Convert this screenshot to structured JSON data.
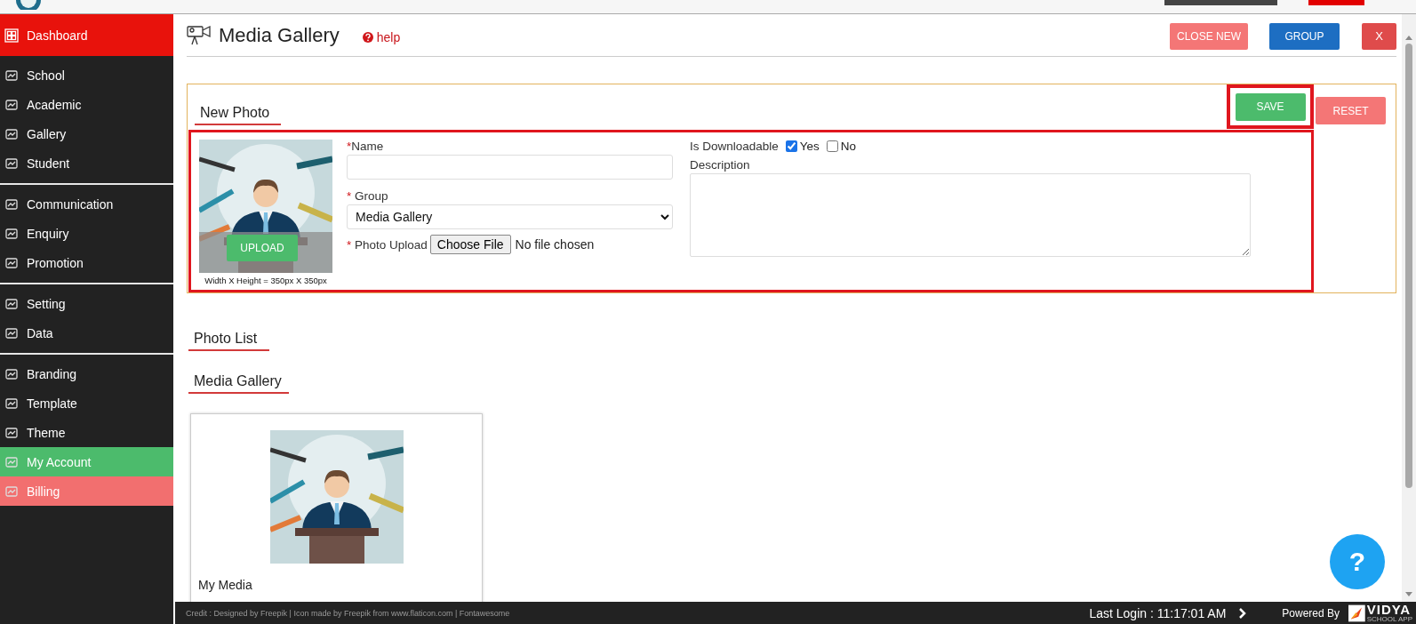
{
  "sidebar": {
    "groups": [
      {
        "items": [
          {
            "label": "Dashboard",
            "color": "#e8120c"
          }
        ]
      },
      {
        "items": [
          {
            "label": "School"
          },
          {
            "label": "Academic"
          },
          {
            "label": "Gallery"
          },
          {
            "label": "Student"
          }
        ]
      },
      {
        "items": [
          {
            "label": "Communication"
          },
          {
            "label": "Enquiry"
          },
          {
            "label": "Promotion"
          }
        ]
      },
      {
        "items": [
          {
            "label": "Setting"
          },
          {
            "label": "Data"
          }
        ]
      },
      {
        "items": [
          {
            "label": "Branding"
          },
          {
            "label": "Template"
          },
          {
            "label": "Theme"
          },
          {
            "label": "My Account",
            "color": "#4cbb6c"
          },
          {
            "label": "Billing",
            "color": "#f26f6f"
          }
        ]
      }
    ]
  },
  "header": {
    "title": "Media Gallery",
    "help": "help",
    "buttons": [
      {
        "label": "CLOSE NEW",
        "kind": "warning"
      },
      {
        "label": "GROUP",
        "kind": "primary"
      },
      {
        "label": "X",
        "kind": "danger"
      }
    ]
  },
  "new_photo": {
    "heading": "New Photo",
    "buttons": [
      {
        "label": "SAVE",
        "kind": "success",
        "highlighted": true
      },
      {
        "label": "RESET",
        "kind": "warning",
        "highlighted": false
      }
    ],
    "upload_button": "UPLOAD",
    "size_hint": "Width X Height = 350px X 350px",
    "name": {
      "label": "Name",
      "required_mark": "*"
    },
    "group": {
      "label": "Group",
      "required_mark": "*",
      "value": "Media Gallery"
    },
    "photo_upload": {
      "label": "Photo Upload",
      "required_mark": "*",
      "button": "Choose File",
      "status": "No file chosen"
    },
    "downloadable": {
      "label": "Is Downloadable",
      "options": [
        {
          "label": "Yes",
          "checked": true
        },
        {
          "label": "No",
          "checked": false
        }
      ]
    },
    "description": {
      "label": "Description"
    }
  },
  "photo_list": {
    "heading": "Photo List"
  },
  "gallery": {
    "heading": "Media Gallery",
    "cards": [
      {
        "kind": "picture",
        "caption": "My Media"
      }
    ]
  },
  "help_fab": "?",
  "footer": {
    "credit": "Credit : Designed by Freepik | Icon made by Freepik from www.flaticon.com | Fontawesome",
    "last_login": "Last Login : 11:17:01 AM",
    "powered_by": "Powered By",
    "logo_name": "VIDYA",
    "logo_tagline": "SCHOOL APP"
  }
}
